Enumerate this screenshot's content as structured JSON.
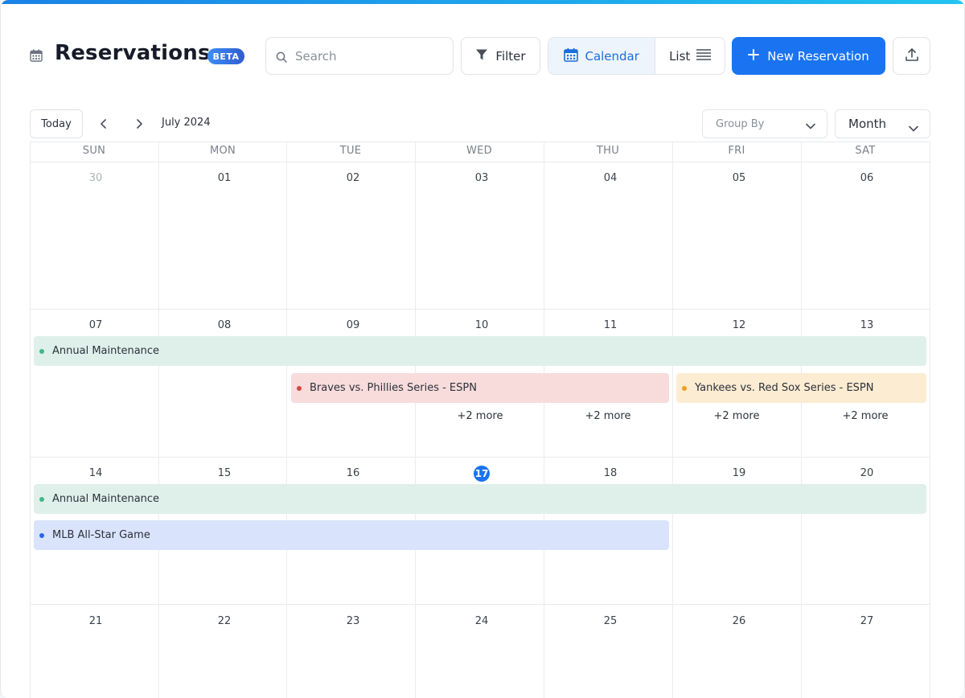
{
  "app": {
    "title": "Reservations",
    "badge": "BETA"
  },
  "header": {
    "search_placeholder": "Search",
    "filter_label": "Filter",
    "view_calendar_label": "Calendar",
    "view_list_label": "List",
    "new_button_label": "New Reservation",
    "active_view": "Calendar"
  },
  "toolbar": {
    "today_label": "Today",
    "month_label": "July 2024",
    "group_by_placeholder": "Group By",
    "view_mode": "Month"
  },
  "calendar": {
    "weekdays": [
      "SUN",
      "MON",
      "TUE",
      "WED",
      "THU",
      "FRI",
      "SAT"
    ],
    "weeks": [
      [
        "30",
        "01",
        "02",
        "03",
        "04",
        "05",
        "06"
      ],
      [
        "07",
        "08",
        "09",
        "10",
        "11",
        "12",
        "13"
      ],
      [
        "14",
        "15",
        "16",
        "17",
        "18",
        "19",
        "20"
      ],
      [
        "21",
        "22",
        "23",
        "24",
        "25",
        "26",
        "27"
      ]
    ],
    "today": "17",
    "events": [
      {
        "label": "Annual Maintenance",
        "color": "#dff0ea",
        "dot": "#43b58a"
      },
      {
        "label": "Braves vs. Phillies Series - ESPN",
        "color": "#f8dcdc",
        "dot": "#d64545"
      },
      {
        "label": "Yankees vs. Red Sox Series - ESPN",
        "color": "#fcecd2",
        "dot": "#f0a020"
      },
      {
        "label": "Annual Maintenance",
        "color": "#dff0ea",
        "dot": "#43b58a"
      },
      {
        "label": "MLB All-Star Game",
        "color": "#d9e3fb",
        "dot": "#2b64e6"
      }
    ],
    "more_label": "+2 more"
  },
  "colors": {
    "accent": "#1a73f0",
    "border": "#dfe3e8"
  }
}
